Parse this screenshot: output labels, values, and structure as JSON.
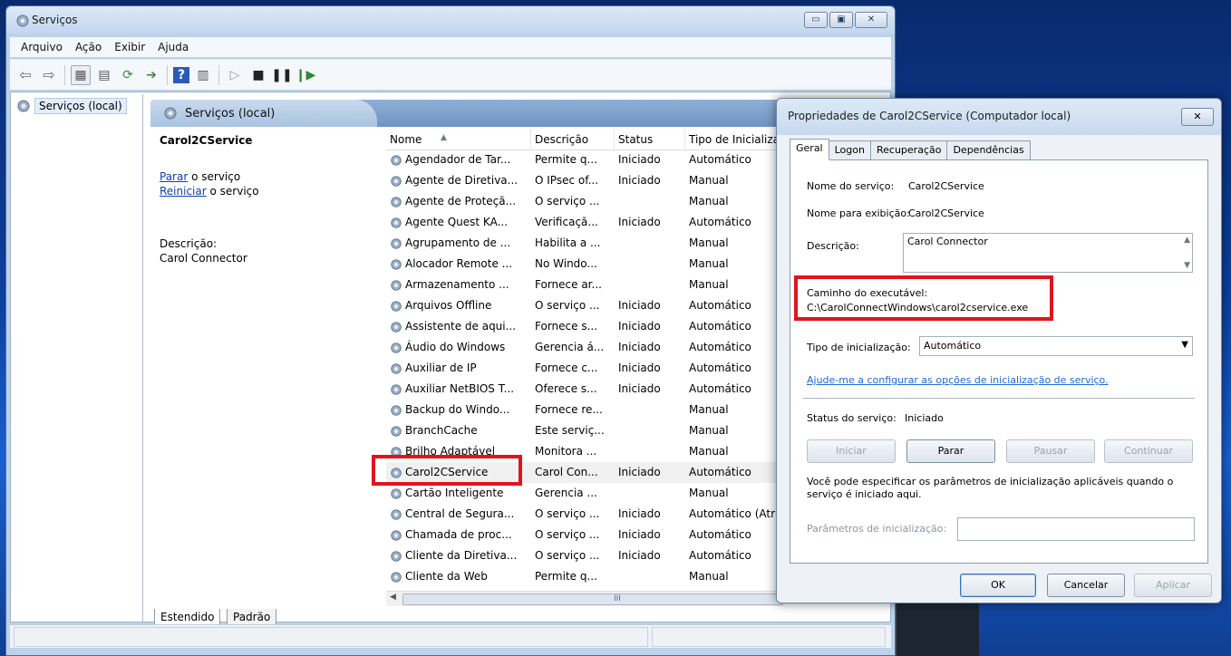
{
  "window": {
    "title": "Serviços",
    "controls": {
      "minimize": "▭",
      "maximize": "▣",
      "close": "✕"
    }
  },
  "menu": [
    "Arquivo",
    "Ação",
    "Exibir",
    "Ajuda"
  ],
  "tree": {
    "root_label": "Serviços (local)"
  },
  "panel": {
    "header": "Serviços (local)"
  },
  "details": {
    "service_name": "Carol2CService",
    "stop_link": "Parar",
    "stop_suffix": " o serviço",
    "restart_link": "Reiniciar",
    "restart_suffix": " o serviço",
    "description_label": "Descrição:",
    "description_value": "Carol Connector"
  },
  "list": {
    "columns": {
      "name": "Nome",
      "description": "Descrição",
      "status": "Status",
      "startup": "Tipo de Inicializa"
    },
    "rows": [
      {
        "name": "Agendador de Tar...",
        "description": "Permite q...",
        "status": "Iniciado",
        "startup": "Automático"
      },
      {
        "name": "Agente de Diretiva...",
        "description": "O IPsec of...",
        "status": "Iniciado",
        "startup": "Manual"
      },
      {
        "name": "Agente de Proteçã...",
        "description": "O serviço ...",
        "status": "",
        "startup": "Manual"
      },
      {
        "name": "Agente Quest KA...",
        "description": "Verificaçã...",
        "status": "Iniciado",
        "startup": "Automático"
      },
      {
        "name": "Agrupamento de ...",
        "description": "Habilita a ...",
        "status": "",
        "startup": "Manual"
      },
      {
        "name": "Alocador Remote ...",
        "description": "No Windo...",
        "status": "",
        "startup": "Manual"
      },
      {
        "name": "Armazenamento ...",
        "description": "Fornece ar...",
        "status": "",
        "startup": "Manual"
      },
      {
        "name": "Arquivos Offline",
        "description": "O serviço ...",
        "status": "Iniciado",
        "startup": "Automático"
      },
      {
        "name": "Assistente de aqui...",
        "description": "Fornece s...",
        "status": "Iniciado",
        "startup": "Automático"
      },
      {
        "name": "Áudio do Windows",
        "description": "Gerencia á...",
        "status": "Iniciado",
        "startup": "Automático"
      },
      {
        "name": "Auxiliar de IP",
        "description": "Fornece c...",
        "status": "Iniciado",
        "startup": "Automático"
      },
      {
        "name": "Auxiliar NetBIOS T...",
        "description": "Oferece s...",
        "status": "Iniciado",
        "startup": "Automático"
      },
      {
        "name": "Backup do Windo...",
        "description": "Fornece re...",
        "status": "",
        "startup": "Manual"
      },
      {
        "name": "BranchCache",
        "description": "Este serviç...",
        "status": "",
        "startup": "Manual"
      },
      {
        "name": "Brilho Adaptável",
        "description": "Monitora ...",
        "status": "",
        "startup": "Manual"
      },
      {
        "name": "Carol2CService",
        "description": "Carol Con...",
        "status": "Iniciado",
        "startup": "Automático"
      },
      {
        "name": "Cartão Inteligente",
        "description": "Gerencia ...",
        "status": "",
        "startup": "Manual"
      },
      {
        "name": "Central de Segura...",
        "description": "O serviço ...",
        "status": "Iniciado",
        "startup": "Automático (Atr"
      },
      {
        "name": "Chamada de proc...",
        "description": "O serviço ...",
        "status": "Iniciado",
        "startup": "Automático"
      },
      {
        "name": "Cliente da Diretiva...",
        "description": "O serviço ...",
        "status": "Iniciado",
        "startup": "Automático"
      },
      {
        "name": "Cliente da Web",
        "description": "Permite q...",
        "status": "",
        "startup": "Manual"
      }
    ],
    "scroll_grip": "III"
  },
  "bottom_tabs": [
    "Estendido",
    "Padrão"
  ],
  "props": {
    "title": "Propriedades de Carol2CService (Computador local)",
    "tabs": [
      "Geral",
      "Logon",
      "Recuperação",
      "Dependências"
    ],
    "service_name_label": "Nome do serviço:",
    "service_name_value": "Carol2CService",
    "display_name_label": "Nome para exibição:",
    "display_name_value": "Carol2CService",
    "description_label": "Descrição:",
    "description_value": "Carol Connector",
    "exe_path_label": "Caminho do executável:",
    "exe_path_value": "C:\\CarolConnectWindows\\carol2cservice.exe",
    "startup_type_label": "Tipo de inicialização:",
    "startup_type_value": "Automático",
    "help_link": "Ajude-me a configurar as opções de inicialização de serviço.",
    "status_label": "Status do serviço:",
    "status_value": "Iniciado",
    "buttons": {
      "start": "Iniciar",
      "stop": "Parar",
      "pause": "Pausar",
      "resume": "Continuar"
    },
    "params_note": "Você pode especificar os parâmetros de inicialização aplicáveis quando o serviço é iniciado aqui.",
    "params_label": "Parâmetros de inicialização:",
    "params_value": "",
    "footer": {
      "ok": "OK",
      "cancel": "Cancelar",
      "apply": "Aplicar"
    }
  },
  "colors": {
    "highlight": "#e0141e",
    "link": "#0a3fb3",
    "titlebar": "#c8d9ee"
  },
  "icons": [
    "gear-icon",
    "back-arrow-icon",
    "forward-arrow-icon",
    "play-icon",
    "stop-icon",
    "pause-icon",
    "restart-icon"
  ]
}
